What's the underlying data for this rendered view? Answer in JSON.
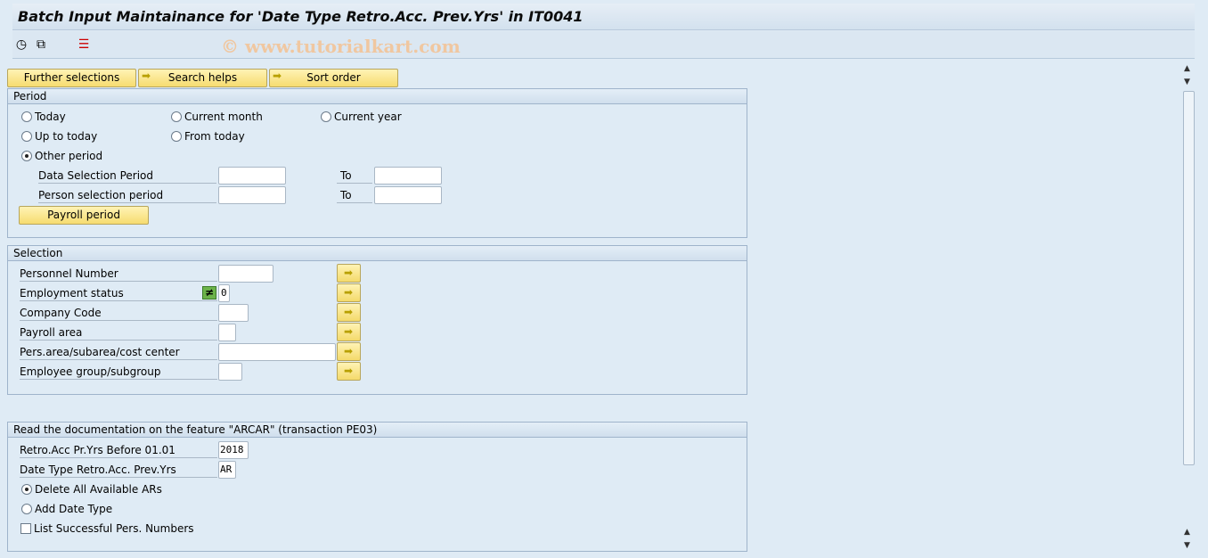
{
  "title": "Batch Input Maintainance for 'Date Type Retro.Acc. Prev.Yrs' in IT0041",
  "toolbar": {
    "icons": [
      "execute-icon",
      "get-variant-icon",
      "selection-options-icon"
    ]
  },
  "watermark": "© www.tutorialkart.com",
  "top_buttons": [
    {
      "label": "Further selections"
    },
    {
      "label": "Search helps"
    },
    {
      "label": "Sort order"
    }
  ],
  "period": {
    "header": "Period",
    "radios": [
      {
        "label": "Today",
        "selected": false
      },
      {
        "label": "Current month",
        "selected": false
      },
      {
        "label": "Current year",
        "selected": false
      },
      {
        "label": "Up to today",
        "selected": false
      },
      {
        "label": "From today",
        "selected": false
      },
      {
        "label": "Other period",
        "selected": true
      }
    ],
    "data_selection_label": "Data Selection Period",
    "person_selection_label": "Person selection period",
    "to_label": "To",
    "payroll_button": "Payroll period"
  },
  "selection": {
    "header": "Selection",
    "rows": [
      {
        "label": "Personnel Number",
        "value": ""
      },
      {
        "label": "Employment status",
        "value": "0",
        "option": "≠"
      },
      {
        "label": "Company Code",
        "value": ""
      },
      {
        "label": "Payroll area",
        "value": ""
      },
      {
        "label": "Pers.area/subarea/cost center",
        "value": ""
      },
      {
        "label": "Employee group/subgroup",
        "value": ""
      }
    ]
  },
  "arcar": {
    "header": "Read the documentation on the feature \"ARCAR\" (transaction PE03)",
    "fields": [
      {
        "label": "Retro.Acc  Pr.Yrs Before 01.01",
        "value": "2018"
      },
      {
        "label": "Date Type Retro.Acc. Prev.Yrs",
        "value": "AR"
      }
    ],
    "radios": [
      {
        "label": "Delete All Available ARs",
        "selected": true
      },
      {
        "label": "Add Date Type",
        "selected": false
      }
    ],
    "checkbox": {
      "label": "List Successful Pers. Numbers",
      "checked": false
    }
  }
}
